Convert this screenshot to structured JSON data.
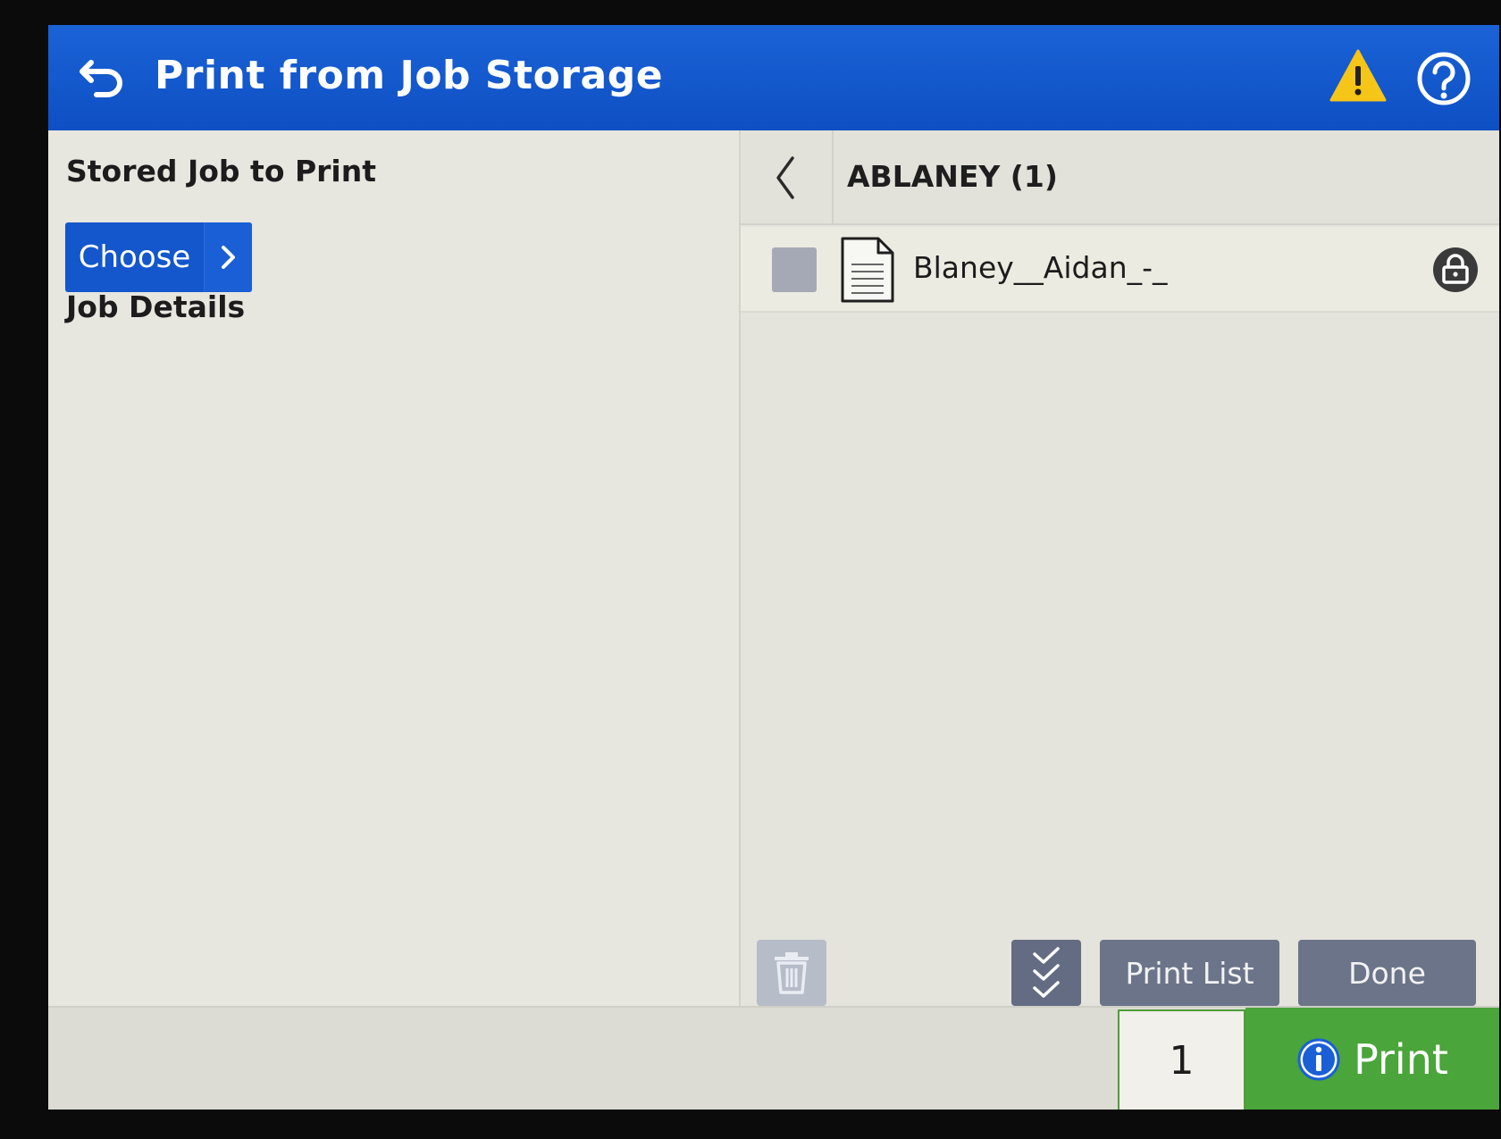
{
  "titlebar": {
    "title": "Print from Job Storage",
    "back_icon": "back-arrow-icon",
    "warning_icon": "warning-icon",
    "help_icon": "help-icon",
    "color": "#1a5fd6"
  },
  "left_pane": {
    "stored_job_label": "Stored Job to Print",
    "choose_button": "Choose",
    "job_details_label": "Job Details"
  },
  "right_pane": {
    "folder_title": "ABLANEY (1)",
    "jobs": [
      {
        "name": "Blaney__Aidan_-_",
        "checked": false,
        "icon": "document-icon",
        "status_icon": "lock-icon"
      }
    ],
    "toolbar": {
      "delete_icon": "trash-icon",
      "select_all_icon": "select-all-icon",
      "print_list_label": "Print List",
      "done_label": "Done"
    }
  },
  "footer": {
    "copies": "1",
    "print_label": "Print",
    "print_color": "#4aa53a"
  }
}
